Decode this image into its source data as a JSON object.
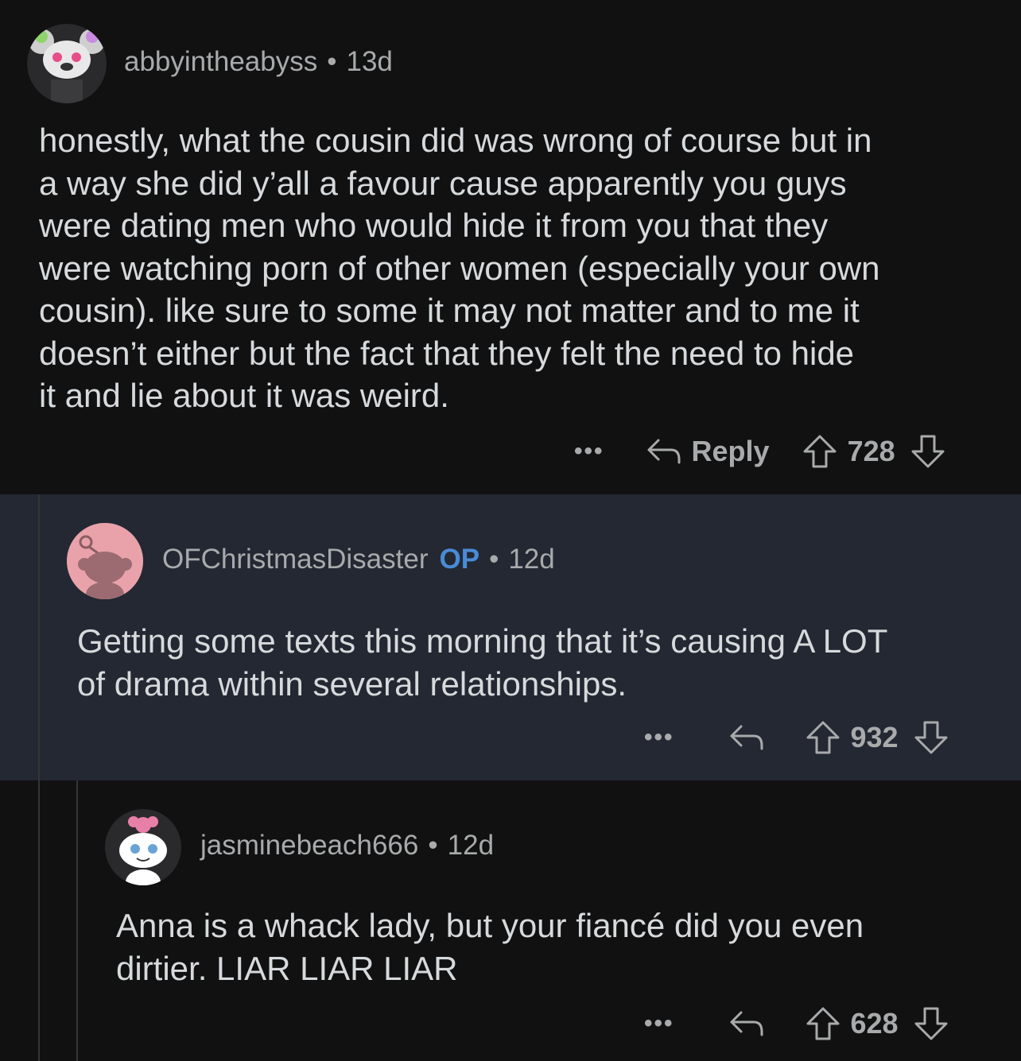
{
  "comments": [
    {
      "username": "abbyintheabyss",
      "op_badge": "",
      "age": "13d",
      "body": "honestly, what the cousin did was wrong of course but  in\na way she did y’all a favour cause apparently you guys\nwere dating men who would hide it from you that they\nwere watching porn of other women (especially your own\ncousin). like sure to some it may not matter and to me it\ndoesn’t either but the fact that they felt the need to hide\nit and lie about it was weird.",
      "more_label": "•••",
      "reply_label": "Reply",
      "votes": "728"
    },
    {
      "username": "OFChristmasDisaster",
      "op_badge": "OP",
      "age": "12d",
      "body": "Getting some texts this morning that it’s causing A LOT\nof drama within several relationships.",
      "more_label": "•••",
      "reply_label": "",
      "votes": "932"
    },
    {
      "username": "jasminebeach666",
      "op_badge": "",
      "age": "12d",
      "body": "Anna is a whack lady, but your fiancé did you even\ndirtier. LIAR LIAR LIAR",
      "more_label": "•••",
      "reply_label": "",
      "votes": "628"
    }
  ],
  "separator": "•",
  "colors": {
    "background": "#111112",
    "highlight_background": "#232833",
    "op_badge": "#4a8bd6",
    "meta_text": "#a8aaab",
    "body_text": "#d7dadc"
  },
  "icons": [
    "reply-arrow-icon",
    "upvote-arrow-icon",
    "downvote-arrow-icon",
    "more-dots-icon"
  ]
}
